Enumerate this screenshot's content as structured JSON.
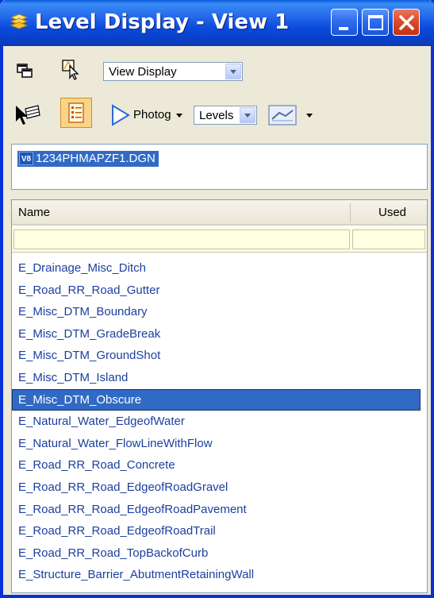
{
  "window": {
    "title": "Level Display - View 1"
  },
  "toolbar": {
    "display_mode_combo": "View Display",
    "photog_label": "Photog",
    "levels_combo": "Levels"
  },
  "file": {
    "badge": "V8",
    "name": "1234PHMAPZF1.DGN"
  },
  "list": {
    "columns": {
      "name": "Name",
      "used": "Used"
    },
    "levels": [
      "E_Drainage_Misc_Ditch",
      "E_Road_RR_Road_Gutter",
      "E_Misc_DTM_Boundary",
      "E_Misc_DTM_GradeBreak",
      "E_Misc_DTM_GroundShot",
      "E_Misc_DTM_Island",
      "E_Misc_DTM_Obscure",
      "E_Natural_Water_EdgeofWater",
      "E_Natural_Water_FlowLineWithFlow",
      "E_Road_RR_Road_Concrete",
      "E_Road_RR_Road_EdgeofRoadGravel",
      "E_Road_RR_Road_EdgeofRoadPavement",
      "E_Road_RR_Road_EdgeofRoadTrail",
      "E_Road_RR_Road_TopBackofCurb",
      "E_Structure_Barrier_AbutmentRetainingWall"
    ],
    "selected_index": 6
  },
  "colors": {
    "titlebar": "#0c4bdc",
    "selection": "#316ac5",
    "list_text": "#1c3fa0",
    "filter_bg": "#ffffe1"
  },
  "icons": [
    "level-display-title-icon",
    "view-group-icon",
    "select-view-icon",
    "combo-arrow-icon",
    "element-select-icon",
    "levels-list-view-icon",
    "photog-filter-icon",
    "symbology-icon"
  ]
}
